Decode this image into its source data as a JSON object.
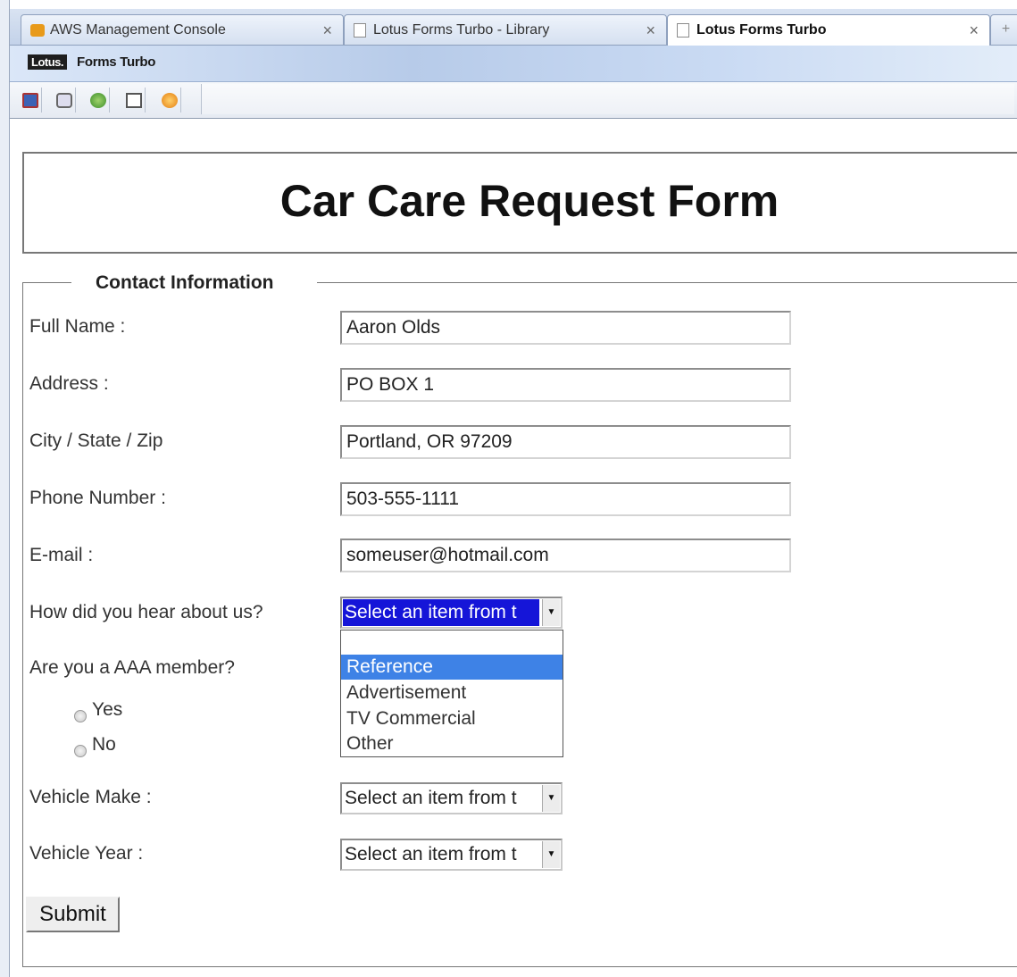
{
  "browser": {
    "tabs": [
      {
        "label": "AWS Management Console",
        "close": "×",
        "icon": "aws-icon"
      },
      {
        "label": "Lotus Forms Turbo - Library",
        "close": "×",
        "icon": "page-icon"
      },
      {
        "label": "Lotus Forms Turbo",
        "close": "×",
        "icon": "page-icon",
        "active": true
      }
    ],
    "new_tab": "+"
  },
  "app": {
    "logo_mark": "Lotus.",
    "logo_text": "Forms Turbo",
    "toolbar": [
      "save-icon",
      "print-icon",
      "refresh-icon",
      "layout-icon",
      "help-icon"
    ]
  },
  "form": {
    "title": "Car Care Request Form",
    "section_legend": "Contact Information",
    "fields": {
      "full_name": {
        "label": "Full Name :",
        "value": "Aaron Olds"
      },
      "address": {
        "label": "Address :",
        "value": "PO BOX 1"
      },
      "city": {
        "label": "City / State / Zip",
        "value": "Portland, OR 97209"
      },
      "phone": {
        "label": "Phone Number :",
        "value": "503-555-1111"
      },
      "email": {
        "label": "E-mail :",
        "value": "someuser@hotmail.com"
      }
    },
    "hear_about": {
      "label": "How did you hear about us?",
      "selected": "Select an item from t",
      "options": [
        "",
        "Reference",
        "Advertisement",
        "TV Commercial",
        "Other"
      ],
      "highlighted": "Reference"
    },
    "aaa": {
      "label": "Are you a AAA member?",
      "yes": "Yes",
      "no": "No"
    },
    "vehicle_make": {
      "label": "Vehicle Make :",
      "selected": "Select an item from t"
    },
    "vehicle_year": {
      "label": "Vehicle Year :",
      "selected": "Select an item from t"
    },
    "submit_label": "Submit"
  },
  "colors": {
    "dropdown_selected": "#1515d8",
    "option_highlight": "#3e82e6"
  }
}
